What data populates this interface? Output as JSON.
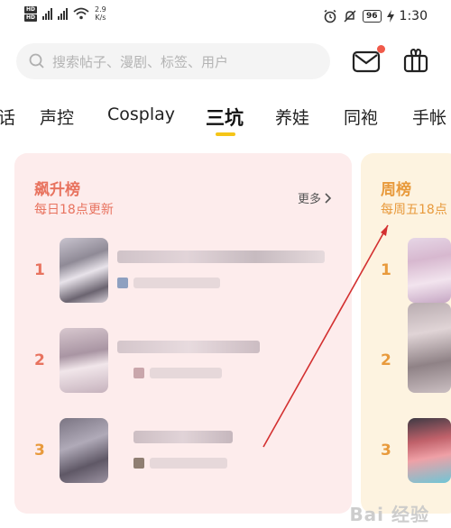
{
  "status_bar": {
    "hd_labels": [
      "HD",
      "HD"
    ],
    "net_speed_value": "2.9",
    "net_speed_unit": "K/s",
    "battery": "96",
    "time": "1:30"
  },
  "search": {
    "placeholder": "搜索帖子、漫剧、标签、用户"
  },
  "tabs": [
    {
      "label": "话"
    },
    {
      "label": "声控"
    },
    {
      "label": "Cosplay"
    },
    {
      "label": "三坑"
    },
    {
      "label": "养娃"
    },
    {
      "label": "同袍"
    },
    {
      "label": "手帐"
    }
  ],
  "active_tab": "三坑",
  "cards": {
    "rising": {
      "title": "飙升榜",
      "subtitle": "每日18点更新",
      "more_label": "更多",
      "ranks": [
        "1",
        "2",
        "3"
      ]
    },
    "weekly": {
      "title": "周榜",
      "subtitle": "每周五18点",
      "ranks": [
        "1",
        "2",
        "3"
      ]
    }
  },
  "watermark": "Bai 经验",
  "colors": {
    "accent_pink": "#e8735f",
    "accent_orange": "#e89a3c",
    "tab_underline": "#f5c518",
    "notification_dot": "#f05a4a"
  }
}
